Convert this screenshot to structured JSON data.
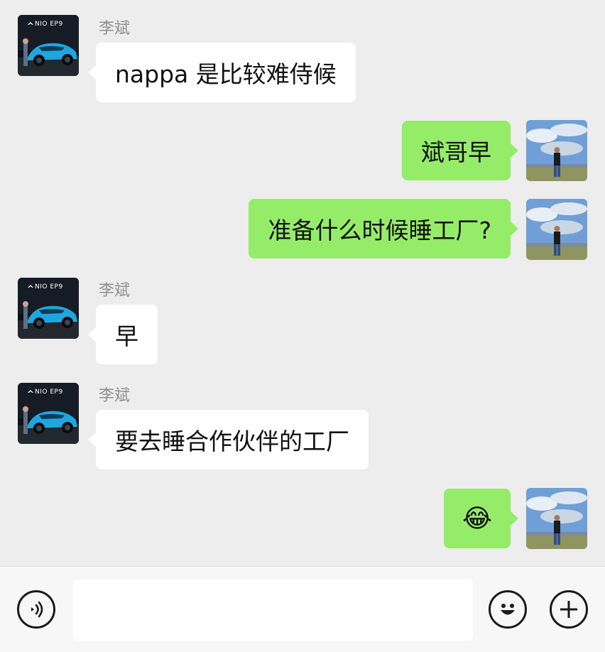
{
  "conversation": {
    "messages": [
      {
        "direction": "incoming",
        "sender": "李斌",
        "text": "nappa 是比较难侍候"
      },
      {
        "direction": "outgoing",
        "text": "斌哥早"
      },
      {
        "direction": "outgoing",
        "text": "准备什么时候睡工厂?"
      },
      {
        "direction": "incoming",
        "sender": "李斌",
        "text": "早"
      },
      {
        "direction": "incoming",
        "sender": "李斌",
        "text": "要去睡合作伙伴的工厂"
      },
      {
        "direction": "outgoing",
        "text": "😂"
      }
    ]
  },
  "contact_avatar": {
    "logo_text": "NIO EP9"
  },
  "input_bar": {
    "voice_icon": "voice-icon",
    "emoji_icon": "emoji-icon",
    "plus_icon": "plus-icon",
    "text_value": ""
  }
}
